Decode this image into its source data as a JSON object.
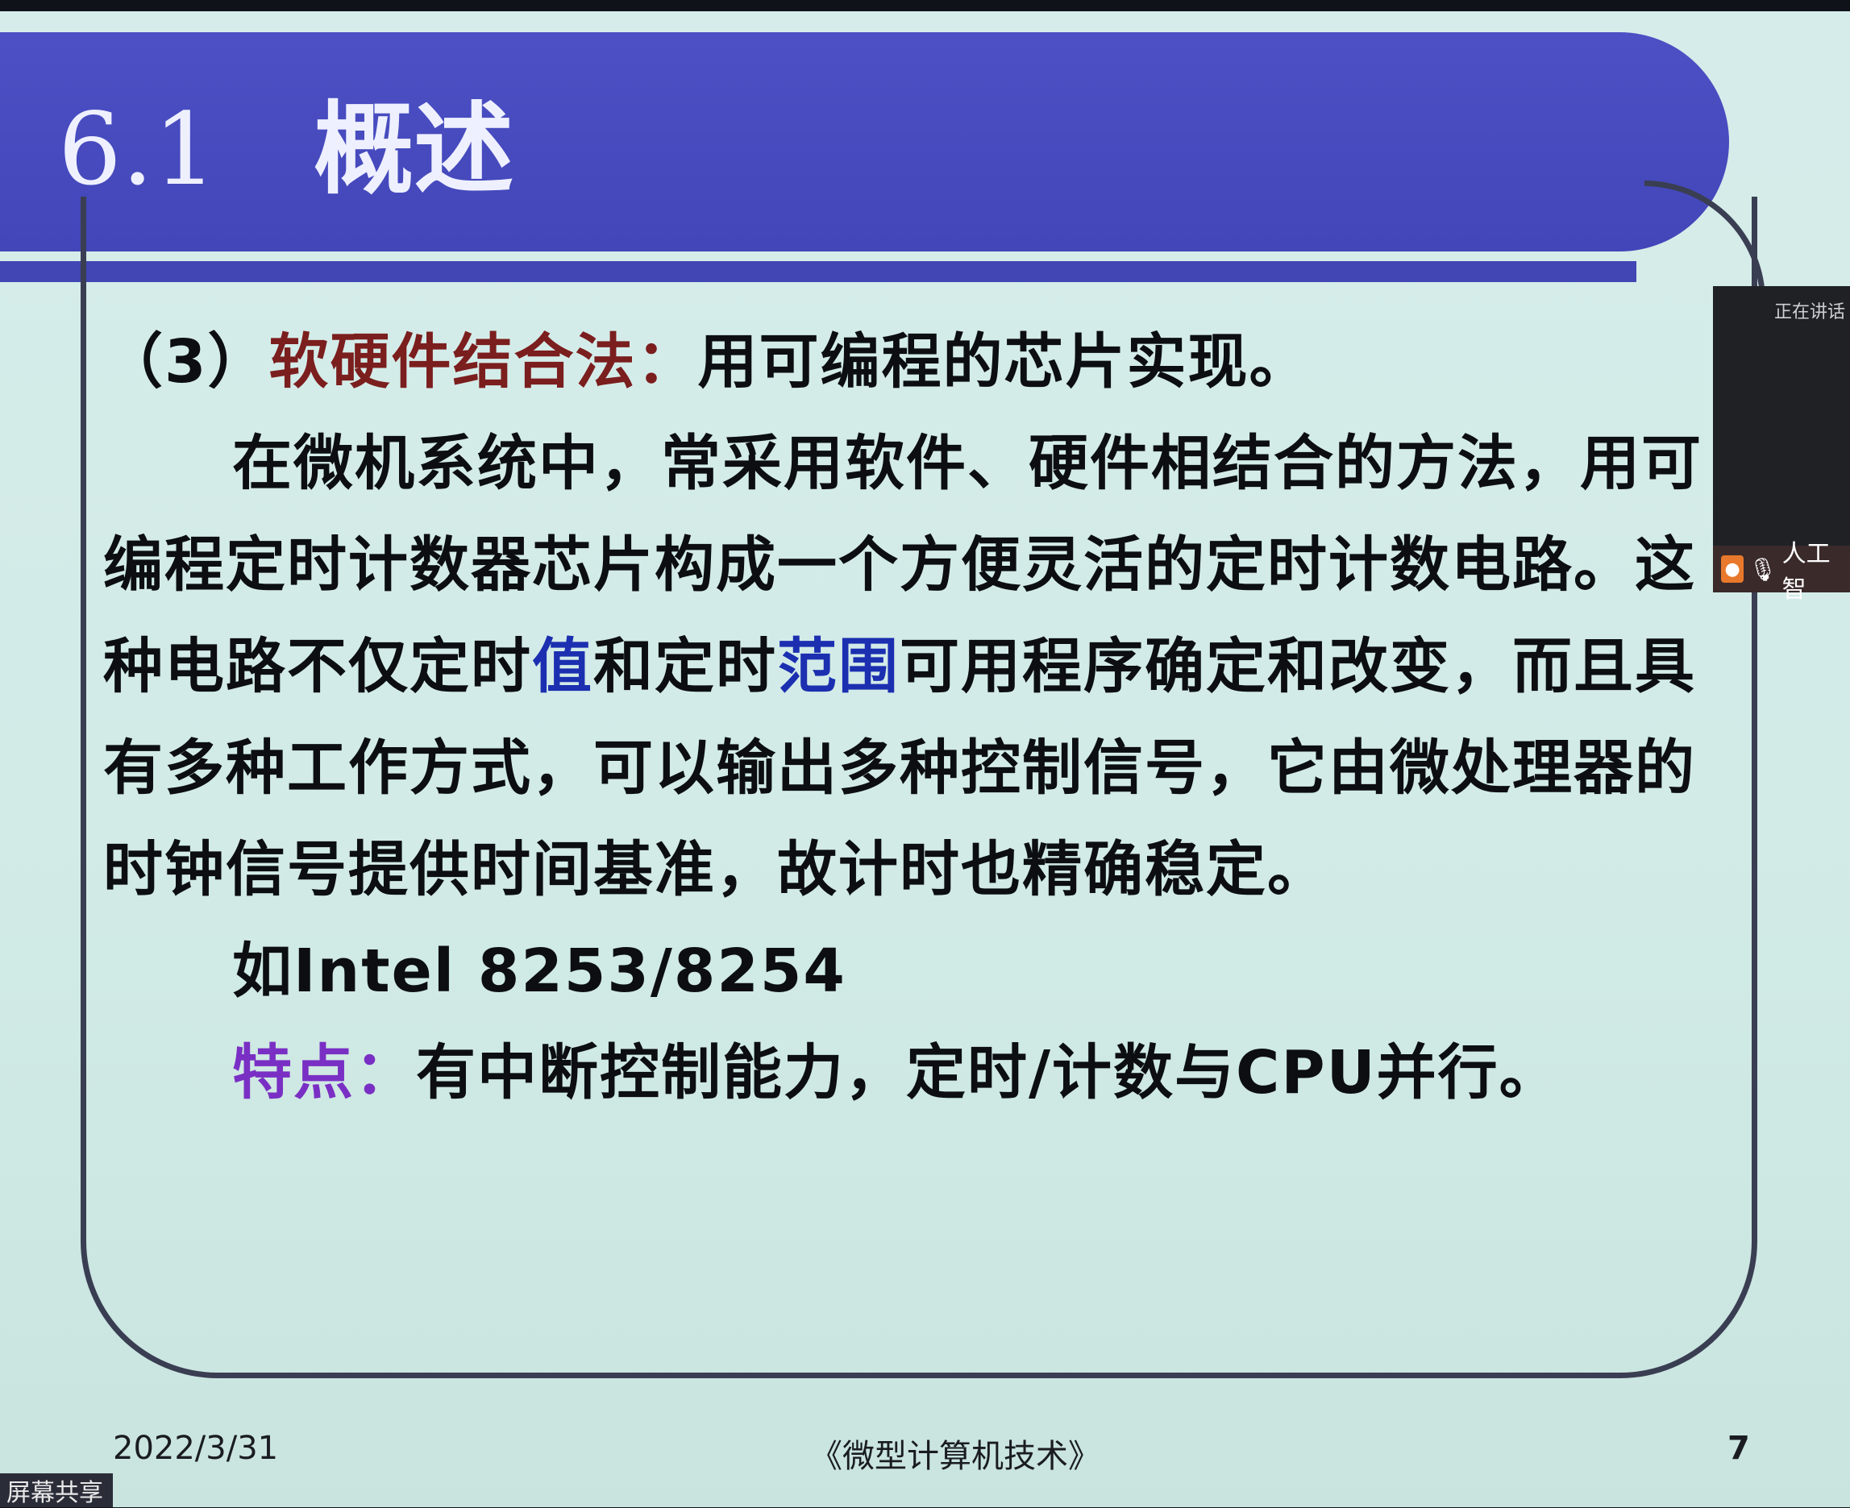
{
  "slide": {
    "section_number": "6.1",
    "section_title": "概述",
    "heading": {
      "prefix": "（3）",
      "term": "软硬件结合法：",
      "rest": "用可编程的芯片实现。"
    },
    "paragraph": [
      "在微机系统中，常采用软件、硬件相结合的方法，用可",
      "编程定时计数器芯片构成一个方便灵活的定时计数电路。这"
    ],
    "line3": {
      "a": "种电路不仅定时",
      "b": "值",
      "c": "和定时",
      "d": "范围",
      "e": "可用程序确定和改变，而且具"
    },
    "line4": "有多种工作方式，可以输出多种控制信号，它由微处理器的",
    "line5": "时钟信号提供时间基准，故计时也精确稳定。",
    "example": "如Intel 8253/8254",
    "feature": {
      "label": "特点：",
      "text": "有中断控制能力，定时/计数与CPU并行。"
    },
    "footer": {
      "date": "2022/3/31",
      "course": "《微型计算机技术》",
      "page": "7"
    }
  },
  "overlay": {
    "speaking_label": "正在讲话",
    "participant_label": "人工智",
    "share_label": "屏幕共享"
  },
  "colors": {
    "title_bar": "#4246b8",
    "term_red": "#7b1e1e",
    "highlight_blue": "#1b2fb0",
    "feature_purple": "#7a2fc4",
    "background": "#d2ebe7"
  }
}
